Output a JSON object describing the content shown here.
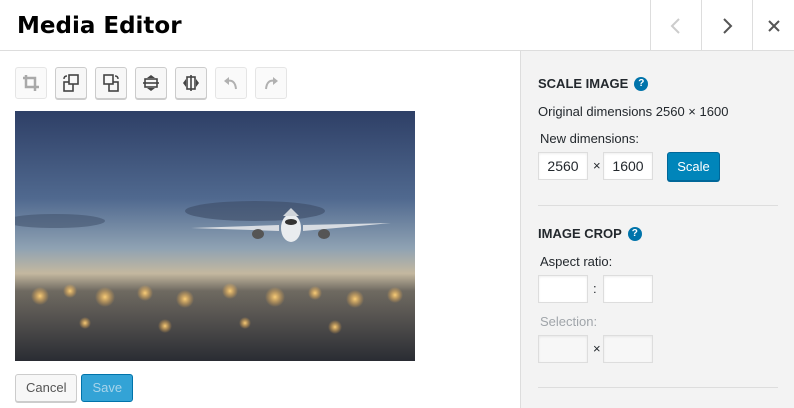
{
  "header": {
    "title": "Media Editor",
    "prev_icon": "‹",
    "next_icon": "›",
    "close_icon": "✕"
  },
  "toolbar": {
    "tools": [
      "crop-icon",
      "rotate-left-icon",
      "rotate-right-icon",
      "flip-vertical-icon",
      "flip-horizontal-icon",
      "undo-icon",
      "redo-icon"
    ]
  },
  "actions": {
    "cancel_label": "Cancel",
    "save_label": "Save"
  },
  "scale": {
    "title": "SCALE IMAGE",
    "help": "?",
    "original": "Original dimensions 2560 × 1600",
    "new_label": "New dimensions:",
    "width": "2560",
    "times": "×",
    "height": "1600",
    "button": "Scale"
  },
  "crop": {
    "title": "IMAGE CROP",
    "help": "?",
    "aspect_label": "Aspect ratio:",
    "aspect_w": "",
    "colon": ":",
    "aspect_h": "",
    "selection_label": "Selection:",
    "sel_w": "",
    "times": "×",
    "sel_h": ""
  },
  "colors": {
    "accent": "#0085ba",
    "sidebar_bg": "#f3f3f3"
  }
}
